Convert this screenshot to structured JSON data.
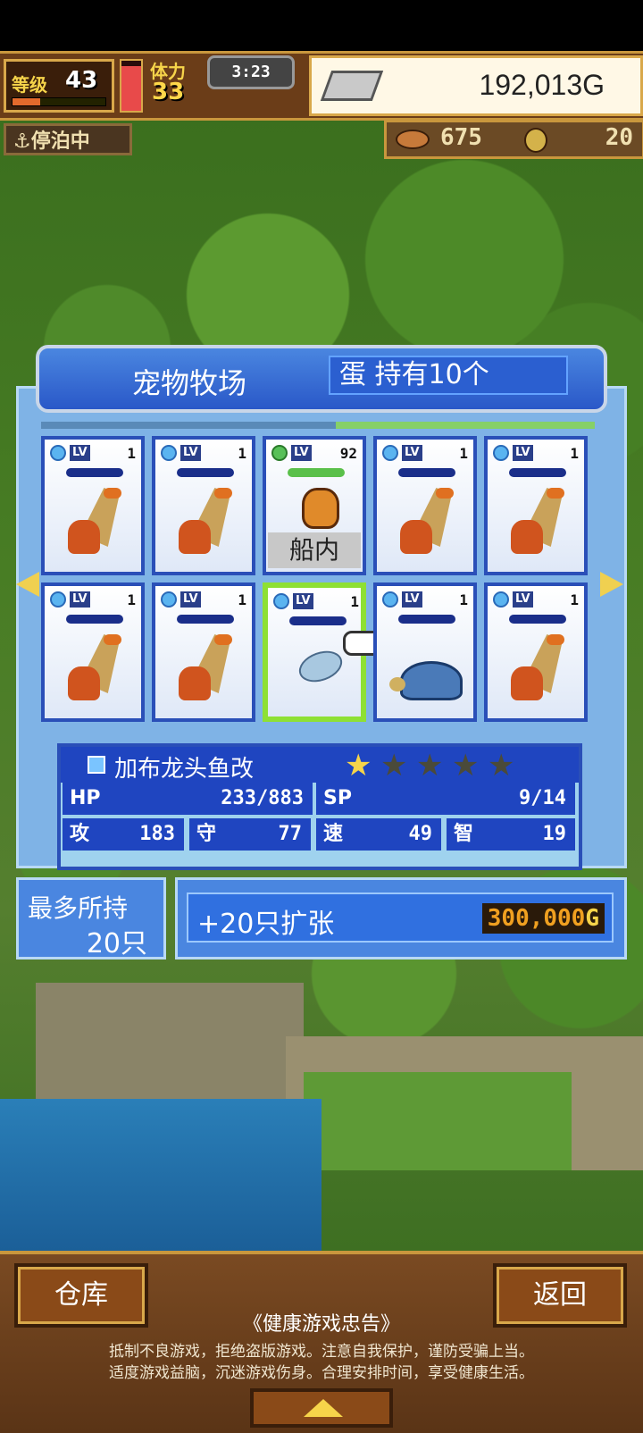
{
  "status": {
    "level_label": "等级",
    "level": "43",
    "stamina_label": "体力",
    "stamina": "33",
    "clock": "3:23",
    "gold": "192,013G",
    "anchor_label": "停泊中",
    "fish_count": "675",
    "coin_count": "20"
  },
  "panel": {
    "title": "宠物牧场",
    "egg_text": "蛋 持有10个"
  },
  "cards": [
    {
      "lv_label": "LV",
      "lv": "1",
      "tag": ""
    },
    {
      "lv_label": "LV",
      "lv": "1",
      "tag": ""
    },
    {
      "lv_label": "LV",
      "lv": "92",
      "tag": "船内"
    },
    {
      "lv_label": "LV",
      "lv": "1",
      "tag": ""
    },
    {
      "lv_label": "LV",
      "lv": "1",
      "tag": ""
    },
    {
      "lv_label": "LV",
      "lv": "1",
      "tag": ""
    },
    {
      "lv_label": "LV",
      "lv": "1",
      "tag": ""
    },
    {
      "lv_label": "LV",
      "lv": "1",
      "tag": ""
    },
    {
      "lv_label": "LV",
      "lv": "1",
      "tag": ""
    },
    {
      "lv_label": "LV",
      "lv": "1",
      "tag": ""
    }
  ],
  "selected_pet": {
    "name": "加布龙头鱼改",
    "stars_filled": 1,
    "stars_total": 5,
    "hp_label": "HP",
    "hp": "233/883",
    "sp_label": "SP",
    "sp": "9/14",
    "atk_label": "攻",
    "atk": "183",
    "def_label": "守",
    "def": "77",
    "spd_label": "速",
    "spd": "49",
    "int_label": "智",
    "int": "19"
  },
  "capacity": {
    "label": "最多所持",
    "value": "20只",
    "expand_label": "+20只扩张",
    "expand_price": "300,000",
    "price_unit": "G"
  },
  "footer": {
    "warehouse_button": "仓库",
    "back_button": "返回",
    "notice_title": "《健康游戏忠告》",
    "notice_line1": "抵制不良游戏，拒绝盗版游戏。注意自我保护，谨防受骗上当。",
    "notice_line2": "适度游戏益脑，沉迷游戏伤身。合理安排时间，享受健康生活。"
  },
  "colors": {
    "accent": "#2a58c8",
    "selected_border": "#8ee034",
    "gold_star": "#f6d44a"
  }
}
